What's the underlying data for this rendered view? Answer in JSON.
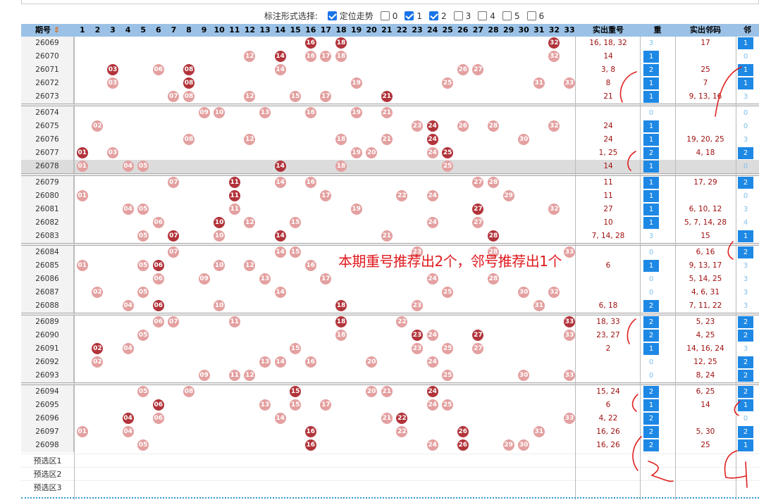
{
  "options": {
    "label": "标注形式选择:",
    "items": [
      {
        "text": "定位走势",
        "checked": true
      },
      {
        "text": "0",
        "checked": false
      },
      {
        "text": "1",
        "checked": true
      },
      {
        "text": "2",
        "checked": true
      },
      {
        "text": "3",
        "checked": false
      },
      {
        "text": "4",
        "checked": false
      },
      {
        "text": "5",
        "checked": false
      },
      {
        "text": "6",
        "checked": false
      }
    ]
  },
  "header": {
    "period": "期号",
    "sort_icon": "sort-arrows-icon",
    "repeat_nums": "实出重号",
    "repeat_count": "重",
    "adjacent_nums": "实出邻码",
    "adjacent_count": "邻"
  },
  "columns": [
    "1",
    "2",
    "3",
    "4",
    "5",
    "6",
    "7",
    "8",
    "9",
    "10",
    "11",
    "12",
    "13",
    "14",
    "15",
    "16",
    "17",
    "18",
    "19",
    "20",
    "21",
    "22",
    "23",
    "24",
    "25",
    "26",
    "27",
    "28",
    "29",
    "30",
    "31",
    "32",
    "33"
  ],
  "rows": [
    {
      "id": "26069",
      "balls": [
        [
          16,
          1
        ],
        [
          18,
          1
        ],
        [
          32,
          1
        ]
      ],
      "rep": "16, 18, 32",
      "rc": "3",
      "rcb": false,
      "adj": "17",
      "ac": "1",
      "acb": true
    },
    {
      "id": "26070",
      "balls": [
        [
          12,
          0
        ],
        [
          14,
          1
        ],
        [
          16,
          0
        ],
        [
          17,
          0
        ],
        [
          18,
          0
        ],
        [
          32,
          0
        ]
      ],
      "rep": "14",
      "rc": "1",
      "rcb": true,
      "adj": "",
      "ac": "0",
      "acb": false
    },
    {
      "id": "26071",
      "balls": [
        [
          3,
          1
        ],
        [
          6,
          0
        ],
        [
          8,
          1
        ],
        [
          14,
          0
        ],
        [
          26,
          0
        ],
        [
          27,
          0
        ]
      ],
      "rep": "3, 8",
      "rc": "2",
      "rcb": true,
      "adj": "25",
      "ac": "1",
      "acb": true
    },
    {
      "id": "26072",
      "balls": [
        [
          3,
          0
        ],
        [
          8,
          1
        ],
        [
          19,
          0
        ],
        [
          25,
          0
        ],
        [
          31,
          0
        ],
        [
          33,
          0
        ]
      ],
      "rep": "8",
      "rc": "1",
      "rcb": true,
      "adj": "7",
      "ac": "1",
      "acb": true
    },
    {
      "id": "26073",
      "balls": [
        [
          7,
          0
        ],
        [
          8,
          0
        ],
        [
          12,
          0
        ],
        [
          15,
          0
        ],
        [
          17,
          0
        ],
        [
          21,
          1
        ]
      ],
      "rep": "21",
      "rc": "1",
      "rcb": true,
      "adj": "9, 13, 16",
      "ac": "3",
      "acb": false
    },
    {
      "id": "26074",
      "balls": [
        [
          9,
          0
        ],
        [
          10,
          0
        ],
        [
          13,
          0
        ],
        [
          16,
          0
        ],
        [
          19,
          0
        ],
        [
          21,
          0
        ]
      ],
      "rep": "",
      "rc": "0",
      "rcb": false,
      "adj": "",
      "ac": "0",
      "acb": false
    },
    {
      "id": "26075",
      "balls": [
        [
          2,
          0
        ],
        [
          23,
          0
        ],
        [
          24,
          1
        ],
        [
          26,
          0
        ],
        [
          28,
          0
        ],
        [
          32,
          0
        ]
      ],
      "rep": "24",
      "rc": "1",
      "rcb": true,
      "adj": "",
      "ac": "0",
      "acb": false
    },
    {
      "id": "26076",
      "balls": [
        [
          8,
          0
        ],
        [
          12,
          0
        ],
        [
          18,
          0
        ],
        [
          21,
          0
        ],
        [
          24,
          1
        ],
        [
          30,
          0
        ]
      ],
      "rep": "24",
      "rc": "1",
      "rcb": true,
      "adj": "19, 20, 25",
      "ac": "3",
      "acb": false
    },
    {
      "id": "26077",
      "balls": [
        [
          1,
          1
        ],
        [
          3,
          0
        ],
        [
          19,
          0
        ],
        [
          20,
          0
        ],
        [
          24,
          0
        ],
        [
          25,
          1
        ]
      ],
      "rep": "1, 25",
      "rc": "2",
      "rcb": true,
      "adj": "4, 18",
      "ac": "2",
      "acb": true
    },
    {
      "id": "26078",
      "balls": [
        [
          1,
          0
        ],
        [
          4,
          0
        ],
        [
          5,
          0
        ],
        [
          14,
          1
        ],
        [
          18,
          0
        ],
        [
          25,
          0
        ]
      ],
      "rep": "14",
      "rc": "1",
      "rcb": true,
      "adj": "",
      "ac": "0",
      "acb": false,
      "alt": true
    },
    {
      "id": "26079",
      "balls": [
        [
          7,
          0
        ],
        [
          11,
          1
        ],
        [
          14,
          0
        ],
        [
          16,
          0
        ],
        [
          27,
          0
        ],
        [
          28,
          0
        ]
      ],
      "rep": "11",
      "rc": "1",
      "rcb": true,
      "adj": "17, 29",
      "ac": "2",
      "acb": true
    },
    {
      "id": "26080",
      "balls": [
        [
          1,
          0
        ],
        [
          11,
          1
        ],
        [
          17,
          0
        ],
        [
          22,
          0
        ],
        [
          24,
          0
        ],
        [
          29,
          0
        ]
      ],
      "rep": "11",
      "rc": "1",
      "rcb": true,
      "adj": "",
      "ac": "0",
      "acb": false
    },
    {
      "id": "26081",
      "balls": [
        [
          4,
          0
        ],
        [
          5,
          0
        ],
        [
          11,
          0
        ],
        [
          19,
          0
        ],
        [
          27,
          1
        ],
        [
          32,
          0
        ]
      ],
      "rep": "27",
      "rc": "1",
      "rcb": true,
      "adj": "6, 10, 12",
      "ac": "3",
      "acb": false
    },
    {
      "id": "26082",
      "balls": [
        [
          6,
          0
        ],
        [
          10,
          1
        ],
        [
          12,
          0
        ],
        [
          15,
          0
        ],
        [
          24,
          0
        ],
        [
          27,
          0
        ]
      ],
      "rep": "10",
      "rc": "1",
      "rcb": true,
      "adj": "5, 7, 14, 28",
      "ac": "4",
      "acb": false
    },
    {
      "id": "26083",
      "balls": [
        [
          5,
          0
        ],
        [
          7,
          1
        ],
        [
          10,
          0
        ],
        [
          14,
          1
        ],
        [
          21,
          0
        ],
        [
          28,
          1
        ]
      ],
      "rep": "7, 14, 28",
      "rc": "3",
      "rcb": false,
      "adj": "15",
      "ac": "1",
      "acb": true
    },
    {
      "id": "26084",
      "balls": [
        [
          7,
          0
        ],
        [
          14,
          0
        ],
        [
          15,
          0
        ],
        [
          23,
          0
        ],
        [
          28,
          0
        ],
        [
          33,
          0
        ]
      ],
      "rep": "",
      "rc": "0",
      "rcb": false,
      "adj": "6, 16",
      "ac": "2",
      "acb": true
    },
    {
      "id": "26085",
      "balls": [
        [
          1,
          0
        ],
        [
          5,
          0
        ],
        [
          6,
          1
        ],
        [
          10,
          0
        ],
        [
          12,
          0
        ],
        [
          16,
          0
        ]
      ],
      "rep": "6",
      "rc": "1",
      "rcb": true,
      "adj": "9, 13, 17",
      "ac": "3",
      "acb": false
    },
    {
      "id": "26086",
      "balls": [
        [
          6,
          0
        ],
        [
          9,
          0
        ],
        [
          13,
          0
        ],
        [
          17,
          0
        ],
        [
          24,
          0
        ],
        [
          28,
          0
        ]
      ],
      "rep": "",
      "rc": "0",
      "rcb": false,
      "adj": "5, 14, 25",
      "ac": "3",
      "acb": false
    },
    {
      "id": "26087",
      "balls": [
        [
          2,
          0
        ],
        [
          5,
          0
        ],
        [
          14,
          0
        ],
        [
          25,
          0
        ],
        [
          30,
          0
        ],
        [
          32,
          0
        ]
      ],
      "rep": "",
      "rc": "0",
      "rcb": false,
      "adj": "4, 6, 31",
      "ac": "3",
      "acb": false
    },
    {
      "id": "26088",
      "balls": [
        [
          4,
          0
        ],
        [
          6,
          1
        ],
        [
          10,
          0
        ],
        [
          18,
          1
        ],
        [
          23,
          0
        ],
        [
          31,
          0
        ]
      ],
      "rep": "6, 18",
      "rc": "2",
      "rcb": true,
      "adj": "7, 11, 22",
      "ac": "3",
      "acb": false
    },
    {
      "id": "26089",
      "balls": [
        [
          6,
          0
        ],
        [
          7,
          0
        ],
        [
          11,
          0
        ],
        [
          18,
          1
        ],
        [
          22,
          0
        ],
        [
          33,
          1
        ]
      ],
      "rep": "18, 33",
      "rc": "2",
      "rcb": true,
      "adj": "5, 23",
      "ac": "2",
      "acb": true
    },
    {
      "id": "26090",
      "balls": [
        [
          5,
          0
        ],
        [
          18,
          0
        ],
        [
          23,
          1
        ],
        [
          24,
          0
        ],
        [
          27,
          1
        ],
        [
          33,
          0
        ]
      ],
      "rep": "23, 27",
      "rc": "2",
      "rcb": true,
      "adj": "4, 25",
      "ac": "2",
      "acb": true
    },
    {
      "id": "26091",
      "balls": [
        [
          2,
          1
        ],
        [
          4,
          0
        ],
        [
          15,
          0
        ],
        [
          23,
          0
        ],
        [
          25,
          0
        ],
        [
          27,
          0
        ]
      ],
      "rep": "2",
      "rc": "1",
      "rcb": true,
      "adj": "14, 16, 24",
      "ac": "3",
      "acb": false
    },
    {
      "id": "26092",
      "balls": [
        [
          2,
          0
        ],
        [
          13,
          0
        ],
        [
          14,
          0
        ],
        [
          16,
          0
        ],
        [
          20,
          0
        ],
        [
          24,
          0
        ]
      ],
      "rep": "",
      "rc": "0",
      "rcb": false,
      "adj": "12, 25",
      "ac": "2",
      "acb": true
    },
    {
      "id": "26093",
      "balls": [
        [
          9,
          0
        ],
        [
          11,
          0
        ],
        [
          12,
          0
        ],
        [
          25,
          0
        ],
        [
          30,
          0
        ],
        [
          33,
          0
        ]
      ],
      "rep": "",
      "rc": "0",
      "rcb": false,
      "adj": "8, 24",
      "ac": "2",
      "acb": true
    },
    {
      "id": "26094",
      "balls": [
        [
          5,
          0
        ],
        [
          8,
          0
        ],
        [
          15,
          1
        ],
        [
          20,
          0
        ],
        [
          21,
          0
        ],
        [
          24,
          1
        ]
      ],
      "rep": "15, 24",
      "rc": "2",
      "rcb": true,
      "adj": "6, 25",
      "ac": "2",
      "acb": true
    },
    {
      "id": "26095",
      "balls": [
        [
          6,
          1
        ],
        [
          13,
          0
        ],
        [
          15,
          0
        ],
        [
          17,
          0
        ],
        [
          24,
          0
        ],
        [
          25,
          0
        ]
      ],
      "rep": "6",
      "rc": "1",
      "rcb": true,
      "adj": "14",
      "ac": "1",
      "acb": true
    },
    {
      "id": "26096",
      "balls": [
        [
          4,
          1
        ],
        [
          6,
          0
        ],
        [
          14,
          0
        ],
        [
          21,
          0
        ],
        [
          22,
          1
        ],
        [
          33,
          0
        ]
      ],
      "rep": "4, 22",
      "rc": "2",
      "rcb": true,
      "adj": "",
      "ac": "0",
      "acb": false
    },
    {
      "id": "26097",
      "balls": [
        [
          1,
          0
        ],
        [
          4,
          0
        ],
        [
          16,
          1
        ],
        [
          22,
          0
        ],
        [
          26,
          1
        ],
        [
          31,
          0
        ]
      ],
      "rep": "16, 26",
      "rc": "2",
      "rcb": true,
      "adj": "5, 30",
      "ac": "2",
      "acb": true
    },
    {
      "id": "26098",
      "balls": [
        [
          5,
          0
        ],
        [
          16,
          1
        ],
        [
          24,
          0
        ],
        [
          26,
          1
        ],
        [
          29,
          0
        ],
        [
          30,
          0
        ]
      ],
      "rep": "16, 26",
      "rc": "2",
      "rcb": true,
      "adj": "25",
      "ac": "1",
      "acb": true
    }
  ],
  "preselect": [
    "预选区1",
    "预选区2",
    "预选区3"
  ],
  "annotation": "本期重号推荐出2个，邻号推荐出1个"
}
